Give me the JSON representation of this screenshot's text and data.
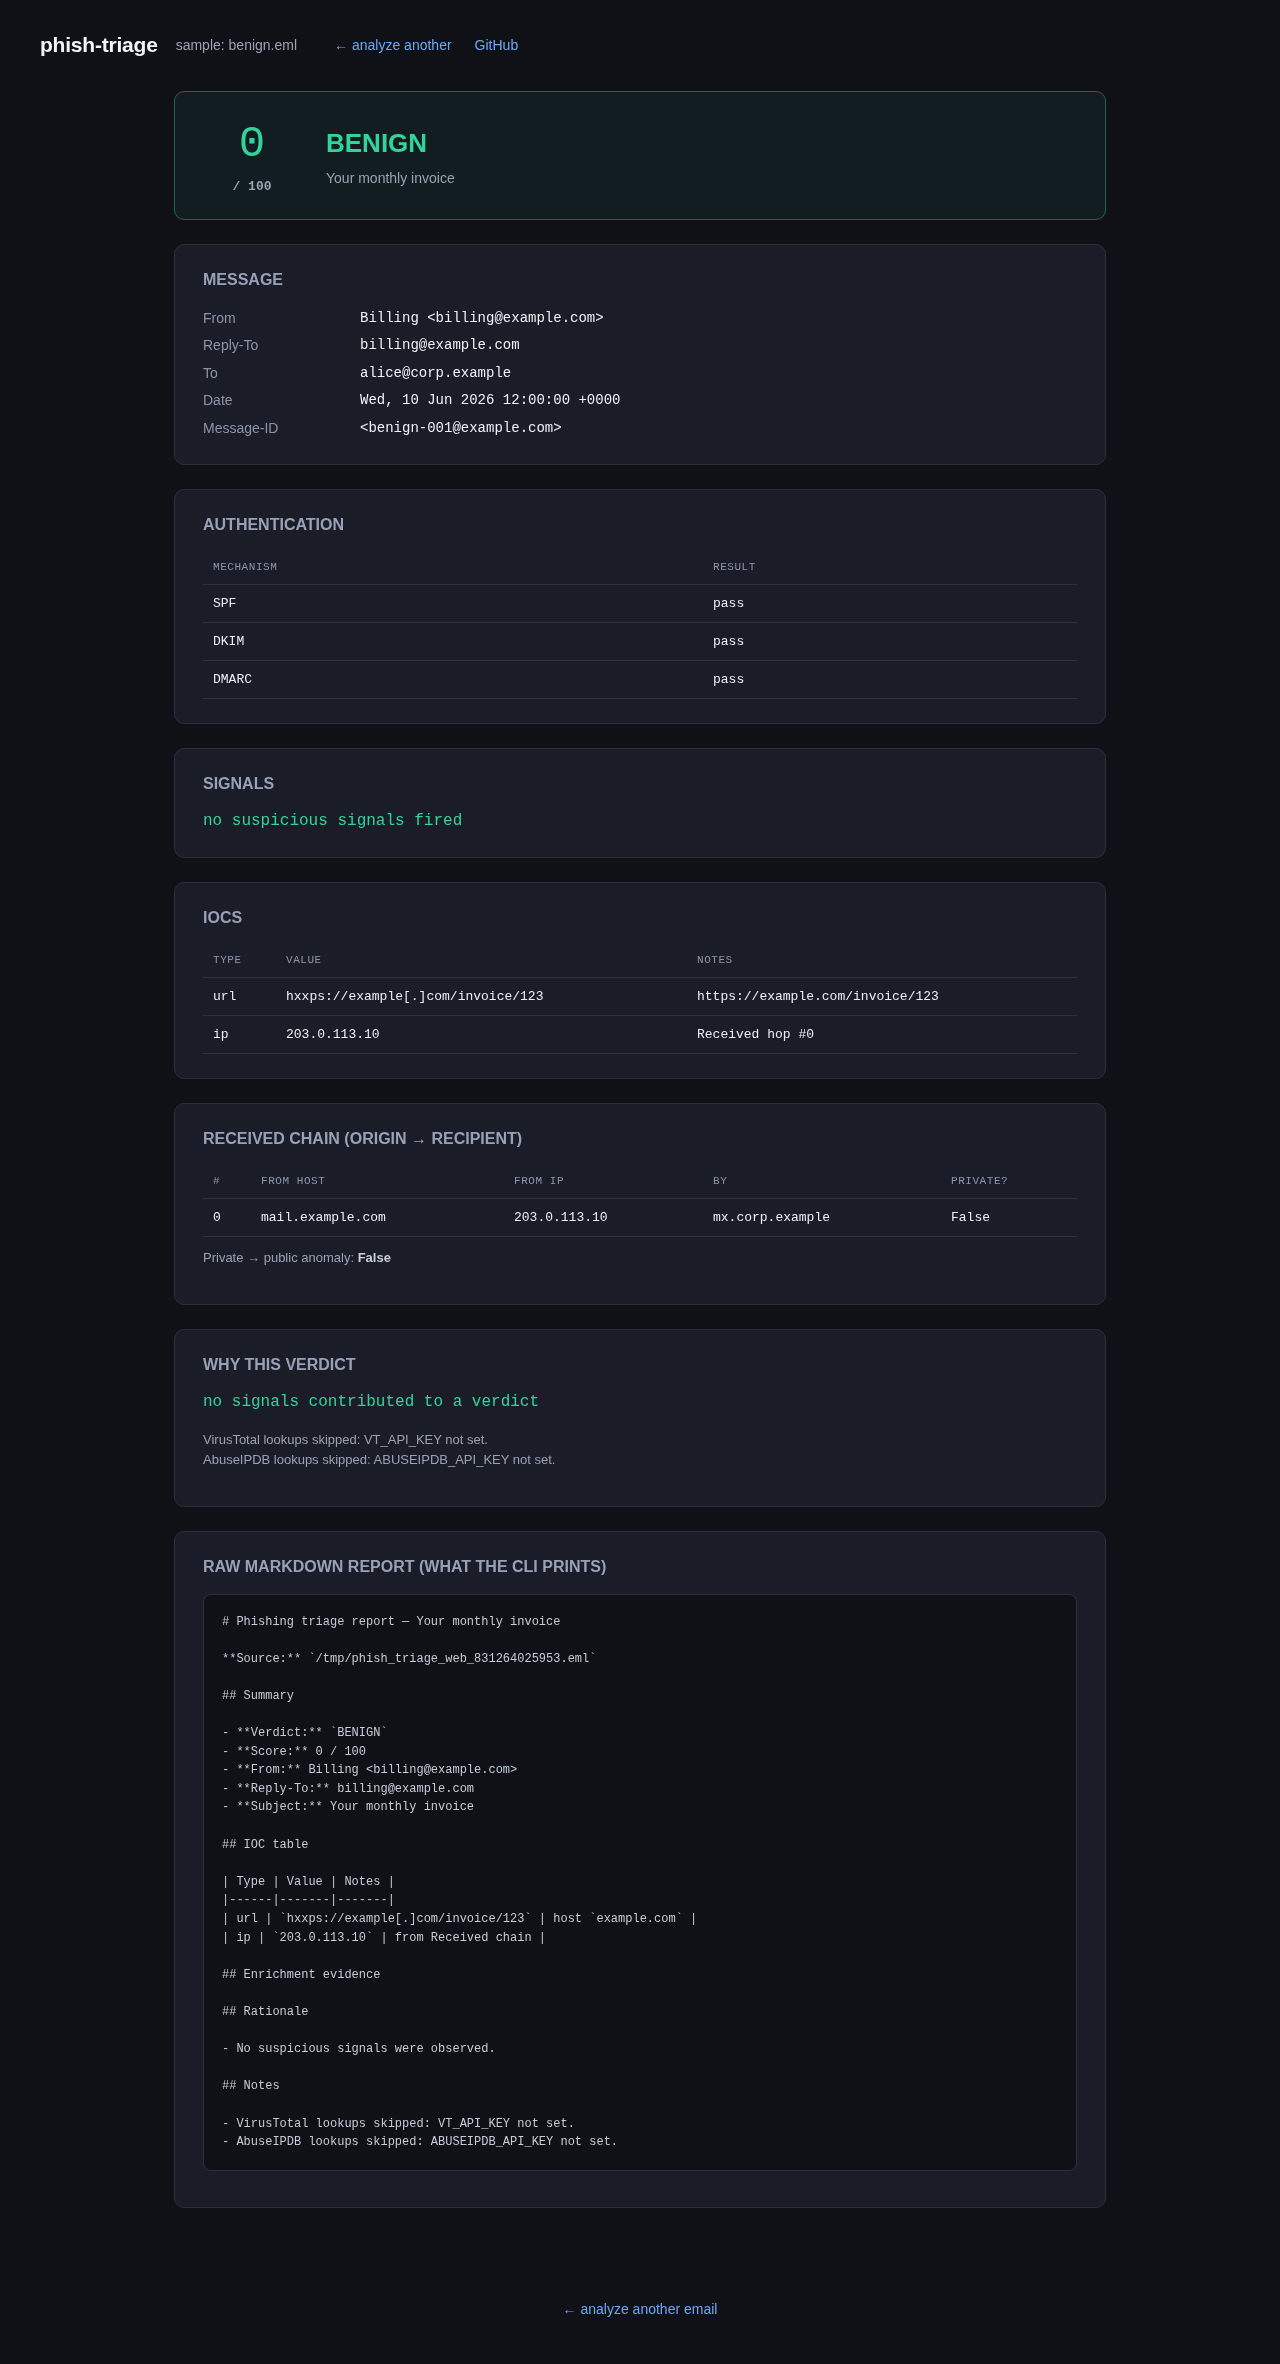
{
  "header": {
    "logo": "phish-triage",
    "sample": "sample: benign.eml",
    "links": [
      "← analyze another",
      "GitHub"
    ]
  },
  "verdict": {
    "score": "0",
    "max": "/ 100",
    "label": "BENIGN",
    "subject": "Your monthly invoice"
  },
  "message": {
    "title": "MESSAGE",
    "fields": [
      {
        "label": "From",
        "value": "Billing <billing@example.com>"
      },
      {
        "label": "Reply-To",
        "value": "billing@example.com"
      },
      {
        "label": "To",
        "value": "alice@corp.example"
      },
      {
        "label": "Date",
        "value": "Wed, 10 Jun 2026 12:00:00 +0000"
      },
      {
        "label": "Message-ID",
        "value": "<benign-001@example.com>"
      }
    ]
  },
  "authentication": {
    "title": "AUTHENTICATION",
    "columns": [
      "MECHANISM",
      "RESULT"
    ],
    "rows": [
      [
        "SPF",
        "pass"
      ],
      [
        "DKIM",
        "pass"
      ],
      [
        "DMARC",
        "pass"
      ]
    ]
  },
  "signals": {
    "title": "SIGNALS",
    "empty_message": "no suspicious signals fired"
  },
  "iocs": {
    "title": "IOCS",
    "columns": [
      "TYPE",
      "VALUE",
      "NOTES"
    ],
    "rows": [
      [
        "url",
        "hxxps://example[.]com/invoice/123",
        "https://example.com/invoice/123"
      ],
      [
        "ip",
        "203.0.113.10",
        "Received hop #0"
      ]
    ]
  },
  "received_chain": {
    "title": "RECEIVED CHAIN (ORIGIN → RECIPIENT)",
    "columns": [
      "#",
      "FROM HOST",
      "FROM IP",
      "BY",
      "PRIVATE?"
    ],
    "rows": [
      [
        "0",
        "mail.example.com",
        "203.0.113.10",
        "mx.corp.example",
        "False"
      ]
    ],
    "note": "Private → public anomaly: **False**"
  },
  "why_verdict": {
    "title": "WHY THIS VERDICT",
    "summary": "no signals contributed to a verdict",
    "notes": [
      "VirusTotal lookups skipped: VT_API_KEY not set.",
      "AbuseIPDB lookups skipped: ABUSEIPDB_API_KEY not set."
    ]
  },
  "raw_report": {
    "title": "RAW MARKDOWN REPORT (WHAT THE CLI PRINTS)",
    "markdown": "# Phishing triage report — Your monthly invoice\n\n**Source:** `/tmp/phish_triage_web_831264025953.eml`\n\n## Summary\n\n- **Verdict:** `BENIGN`\n- **Score:** 0 / 100\n- **From:** Billing <billing@example.com>\n- **Reply-To:** billing@example.com\n- **Subject:** Your monthly invoice\n\n## IOC table\n\n| Type | Value | Notes |\n|------|-------|-------|\n| url | `hxxps://example[.]com/invoice/123` | host `example.com` |\n| ip | `203.0.113.10` | from Received chain |\n\n## Enrichment evidence\n\n## Rationale\n\n- No suspicious signals were observed.\n\n## Notes\n\n- VirusTotal lookups skipped: VT_API_KEY not set.\n- AbuseIPDB lookups skipped: ABUSEIPDB_API_KEY not set."
  },
  "footer": {
    "link": "← analyze another email"
  }
}
